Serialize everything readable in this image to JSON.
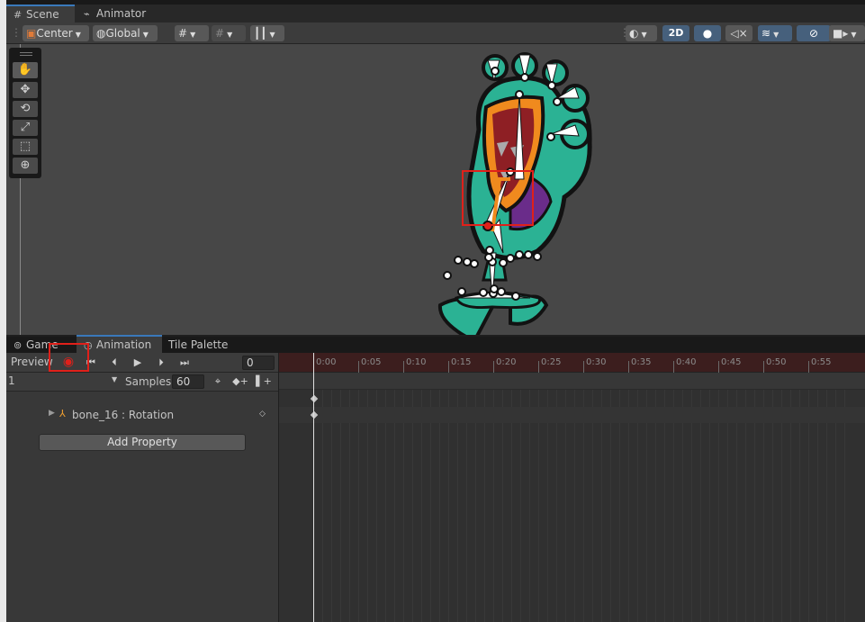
{
  "scene_tabs": [
    {
      "icon": "#",
      "label": "Scene"
    },
    {
      "icon": "⌁",
      "label": "Animator"
    }
  ],
  "scene_toolbar": {
    "pivot": "Center",
    "space": "Global",
    "mode_2d": "2D"
  },
  "bottom_tabs": [
    {
      "label": "Game"
    },
    {
      "label": "Animation"
    },
    {
      "label": "Tile Palette"
    }
  ],
  "animation": {
    "preview_label": "Preview",
    "frame_value": "0",
    "clip_name": "1",
    "samples_label": "Samples",
    "samples_value": "60",
    "property_name": "bone_16 : Rotation",
    "add_property_label": "Add Property",
    "timeline_labels": [
      "0:00",
      "0:05",
      "0:10",
      "0:15",
      "0:20",
      "0:25",
      "0:30",
      "0:35",
      "0:40",
      "0:45",
      "0:50",
      "0:55"
    ]
  },
  "colors": {
    "accent_blue": "#46607c",
    "record_red": "#e0201a",
    "ruler_record_tint": "#3c1e1e"
  }
}
